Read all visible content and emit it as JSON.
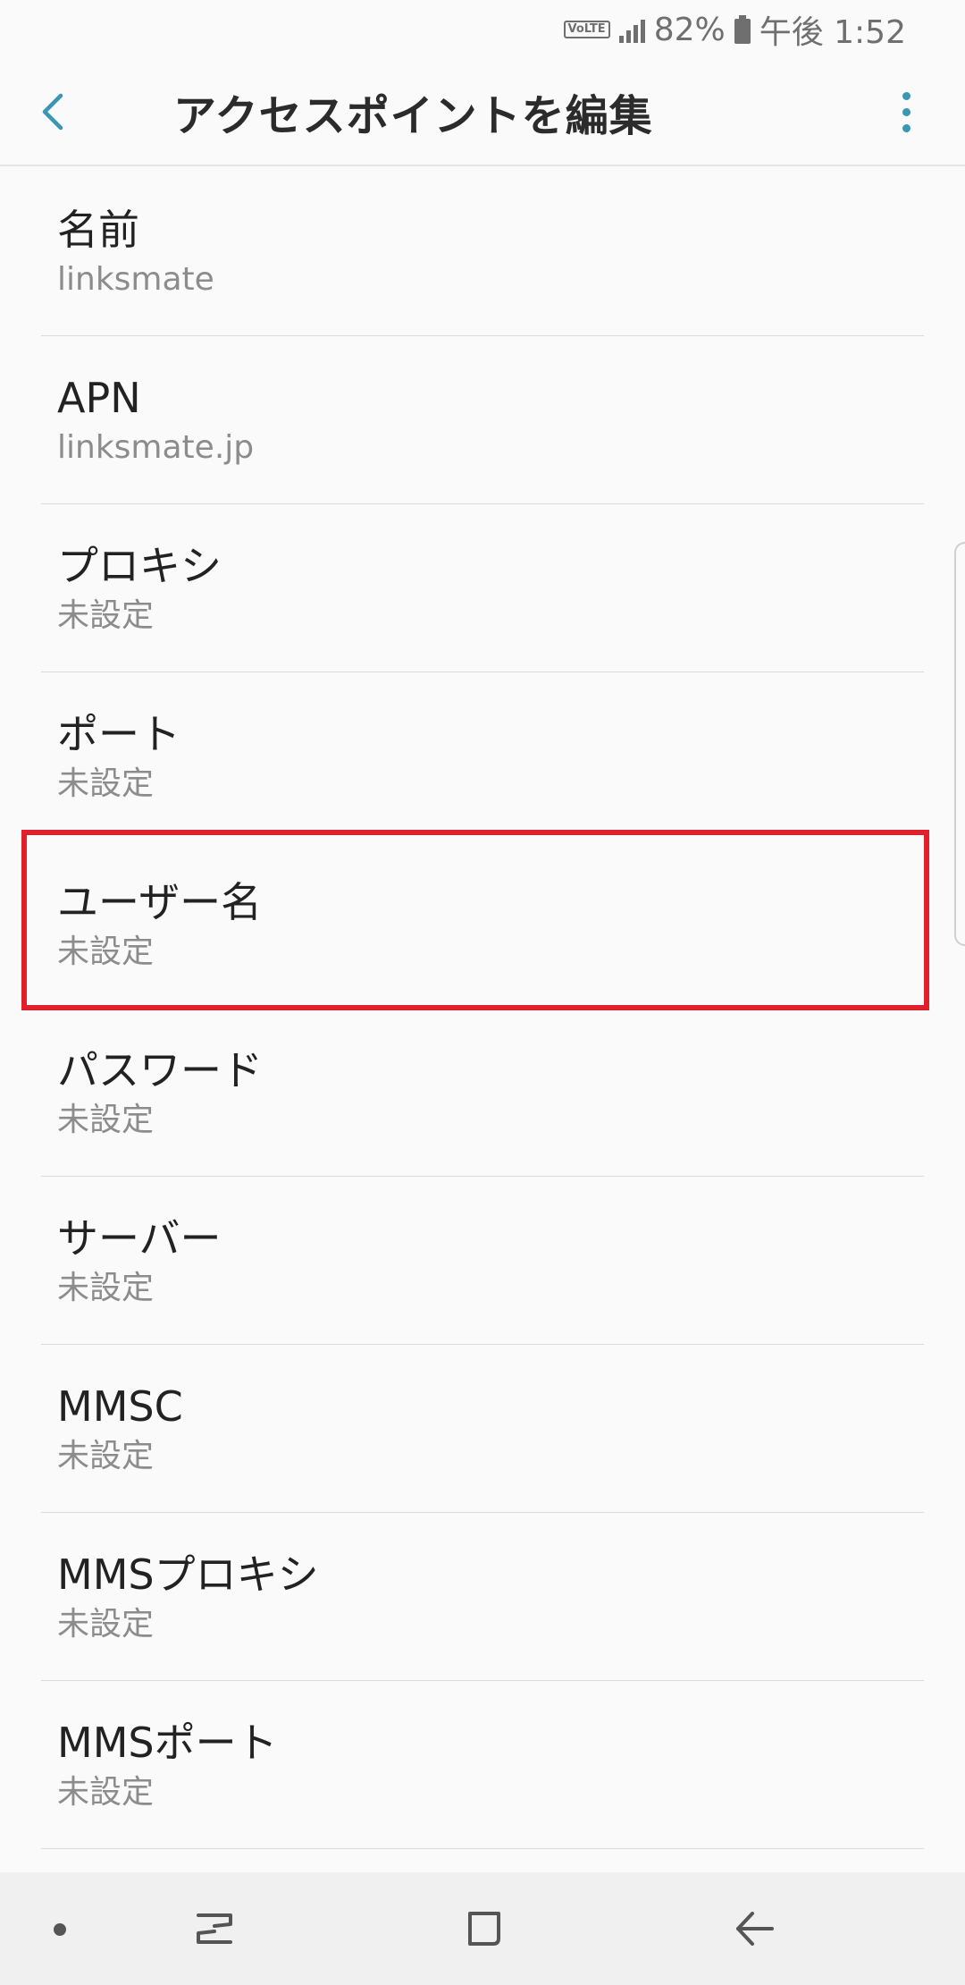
{
  "status_bar": {
    "volte": "VoLTE",
    "battery_percent": "82%",
    "time": "午後 1:52"
  },
  "app_bar": {
    "title": "アクセスポイントを編集",
    "back_icon": "chevron-left-icon",
    "more_icon": "more-vertical-icon",
    "accent_color": "#3a97b3"
  },
  "items": [
    {
      "title": "名前",
      "value": "linksmate"
    },
    {
      "title": "APN",
      "value": "linksmate.jp"
    },
    {
      "title": "プロキシ",
      "value": "未設定"
    },
    {
      "title": "ポート",
      "value": "未設定"
    },
    {
      "title": "ユーザー名",
      "value": "未設定"
    },
    {
      "title": "パスワード",
      "value": "未設定"
    },
    {
      "title": "サーバー",
      "value": "未設定"
    },
    {
      "title": "MMSC",
      "value": "未設定"
    },
    {
      "title": "MMSプロキシ",
      "value": "未設定"
    },
    {
      "title": "MMSポート",
      "value": "未設定"
    }
  ],
  "highlight_color": "#e0202a",
  "nav_bar": {
    "recent_icon": "recent-apps-icon",
    "home_icon": "home-icon",
    "back_icon": "back-arrow-icon"
  }
}
